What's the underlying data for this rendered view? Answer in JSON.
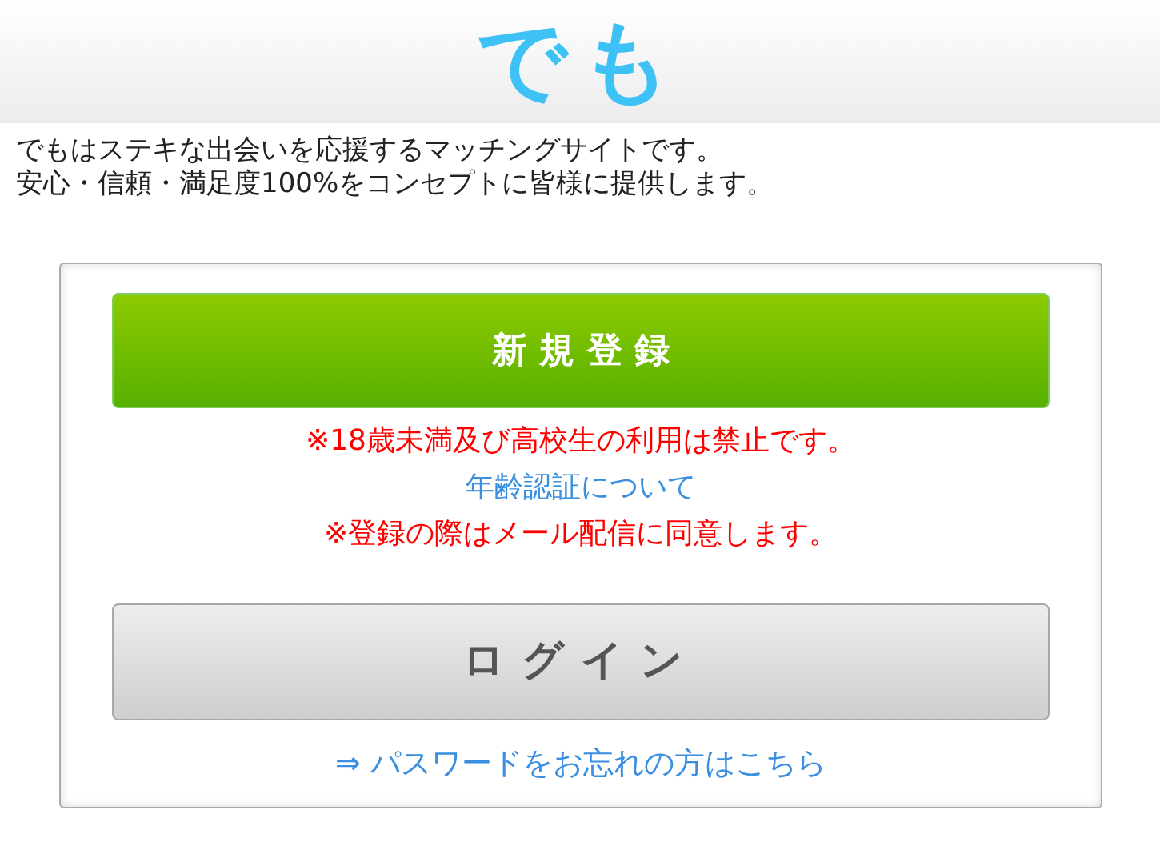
{
  "header": {
    "logo": "でも"
  },
  "intro": [
    "でもはステキな出会いを応援するマッチングサイトです。",
    "安心・信頼・満足度100%をコンセプトに皆様に提供します。"
  ],
  "register_button": "新 規 登 録",
  "notices": [
    {
      "kind": "warning",
      "text": "※18歳未満及び高校生の利用は禁止です。"
    },
    {
      "kind": "link",
      "text": "年齢認証について"
    },
    {
      "kind": "warning",
      "text": "※登録の際はメール配信に同意します。"
    }
  ],
  "login_button": "ログイン",
  "password_link": "⇒ パスワードをお忘れの方はこちら"
}
